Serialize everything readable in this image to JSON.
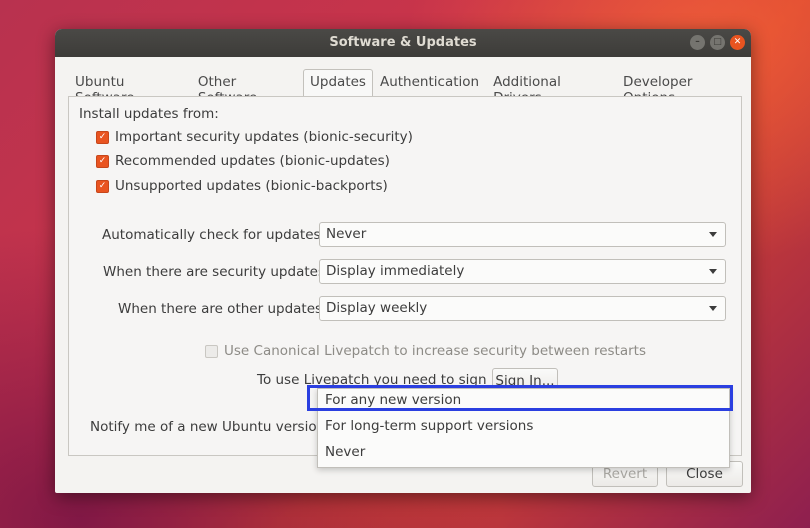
{
  "window": {
    "title": "Software & Updates"
  },
  "tabs": [
    "Ubuntu Software",
    "Other Software",
    "Updates",
    "Authentication",
    "Additional Drivers",
    "Developer Options"
  ],
  "updates": {
    "install_from_label": "Install updates from:",
    "checkboxes": [
      {
        "label": "Important security updates (bionic-security)",
        "checked": true
      },
      {
        "label": "Recommended updates (bionic-updates)",
        "checked": true
      },
      {
        "label": "Unsupported updates (bionic-backports)",
        "checked": true
      }
    ],
    "auto_check_label": "Automatically check for updates:",
    "auto_check_value": "Never",
    "security_label": "When there are security updates:",
    "security_value": "Display immediately",
    "other_label": "When there are other updates:",
    "other_value": "Display weekly",
    "livepatch_label": "Use Canonical Livepatch to increase security between restarts",
    "livepatch_signin_text": "To use Livepatch you need to sign in.",
    "sign_in_button": "Sign In...",
    "notify_label": "Notify me of a new Ubuntu version:",
    "notify_options": [
      "For any new version",
      "For long-term support versions",
      "Never"
    ]
  },
  "buttons": {
    "revert": "Revert",
    "close": "Close"
  },
  "colors": {
    "accent": "#e95420",
    "highlight": "#2b3fe0"
  }
}
